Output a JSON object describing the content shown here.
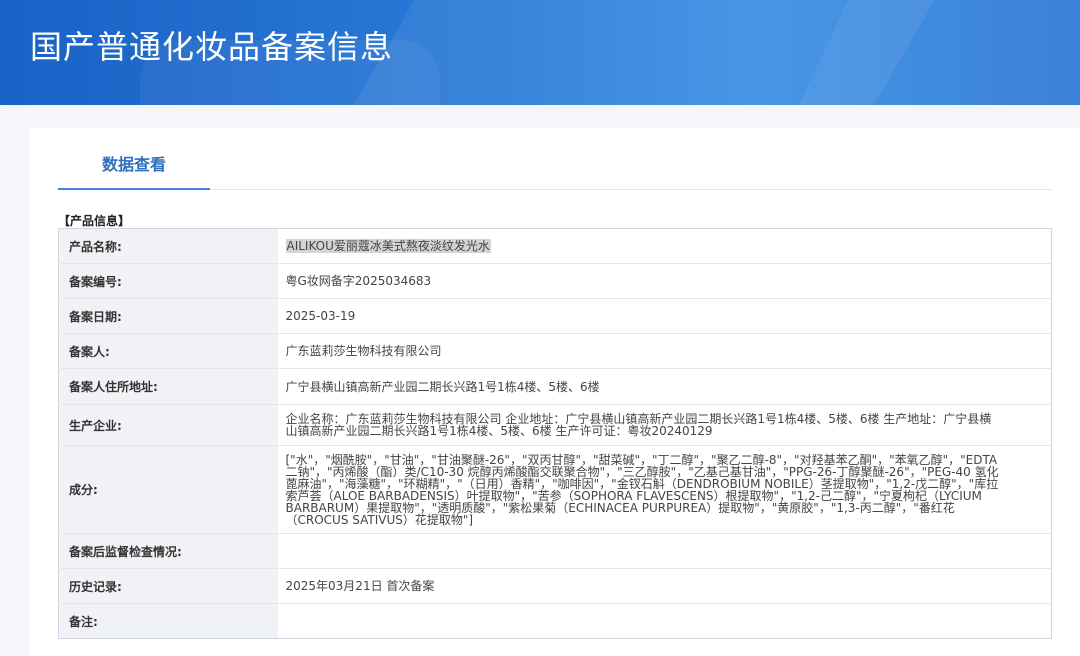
{
  "header": {
    "title": "国产普通化妆品备案信息"
  },
  "tabs": [
    {
      "label": "数据查看"
    }
  ],
  "section": {
    "title": "【产品信息】"
  },
  "rows": [
    {
      "label": "产品名称:",
      "value": "AILIKOU爱丽蔻冰美式熬夜淡纹发光水"
    },
    {
      "label": "备案编号:",
      "value": "粤G妆网备字2025034683"
    },
    {
      "label": "备案日期:",
      "value": "2025-03-19"
    },
    {
      "label": "备案人:",
      "value": "广东蓝莉莎生物科技有限公司"
    },
    {
      "label": "备案人住所地址:",
      "value": "广宁县横山镇高新产业园二期长兴路1号1栋4楼、5楼、6楼"
    },
    {
      "label": "生产企业:",
      "value": "企业名称：广东蓝莉莎生物科技有限公司 企业地址：广宁县横山镇高新产业园二期长兴路1号1栋4楼、5楼、6楼 生产地址：广宁县横山镇高新产业园二期长兴路1号1栋4楼、5楼、6楼 生产许可证：粤妆20240129"
    },
    {
      "label": "成分:",
      "value": "[\"水\"，\"烟酰胺\"，\"甘油\"，\"甘油聚醚-26\"，\"双丙甘醇\"，\"甜菜碱\"，\"丁二醇\"，\"聚乙二醇-8\"，\"对羟基苯乙酮\"，\"苯氧乙醇\"，\"EDTA 二钠\"，\"丙烯酸（酯）类/C10-30 烷醇丙烯酸酯交联聚合物\"，\"三乙醇胺\"，\"乙基己基甘油\"，\"PPG-26-丁醇聚醚-26\"，\"PEG-40 氢化蓖麻油\"，\"海藻糖\"，\"环糊精\"，\"（日用）香精\"，\"咖啡因\"，\"金钗石斛（DENDROBIUM NOBILE）茎提取物\"，\"1,2-戊二醇\"，\"库拉索芦荟（ALOE BARBADENSIS）叶提取物\"，\"苦参（SOPHORA FLAVESCENS）根提取物\"，\"1,2-己二醇\"，\"宁夏枸杞（LYCIUM BARBARUM）果提取物\"，\"透明质酸\"，\"紫松果菊（ECHINACEA PURPUREA）提取物\"，\"黄原胶\"，\"1,3-丙二醇\"，\"番红花（CROCUS SATIVUS）花提取物\"]"
    },
    {
      "label": "备案后监督检查情况:",
      "value": ""
    },
    {
      "label": "历史记录:",
      "value": "2025年03月21日 首次备案"
    },
    {
      "label": "备注:",
      "value": ""
    }
  ],
  "colors": {
    "banner": "#2a7ad8",
    "tab_accent": "#3d86d8",
    "label_bg": "#f0f2f5"
  }
}
